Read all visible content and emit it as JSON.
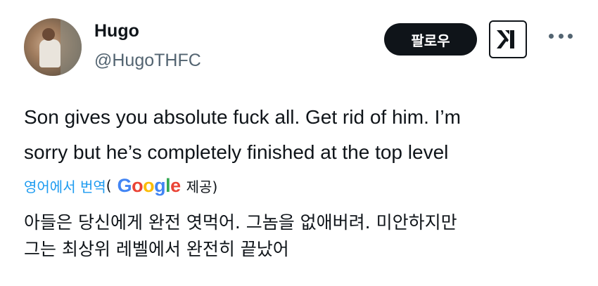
{
  "user": {
    "name": "Hugo",
    "handle": "@HugoTHFC"
  },
  "actions": {
    "follow_label": "팔로우"
  },
  "tweet": {
    "line1": "Son gives you absolute fuck all. Get rid of him. I’m",
    "line2": "sorry but he’s completely finished at the top level"
  },
  "translation": {
    "link_label": "영어에서 번역",
    "open_paren": "(",
    "google": [
      "G",
      "o",
      "o",
      "g",
      "l",
      "e"
    ],
    "google_colors": [
      "#4285F4",
      "#EA4335",
      "#FBBC05",
      "#4285F4",
      "#34A853",
      "#EA4335"
    ],
    "provide_label": "제공)",
    "line1": "아들은 당신에게 완전 엿먹어. 그놈을 없애버려. 미안하지만",
    "line2": "그는 최상위 레벨에서 완전히 끝났어"
  },
  "icons": {
    "avatar": "profile-photo",
    "x_logo": "x-logo-icon",
    "more": "more-icon"
  }
}
